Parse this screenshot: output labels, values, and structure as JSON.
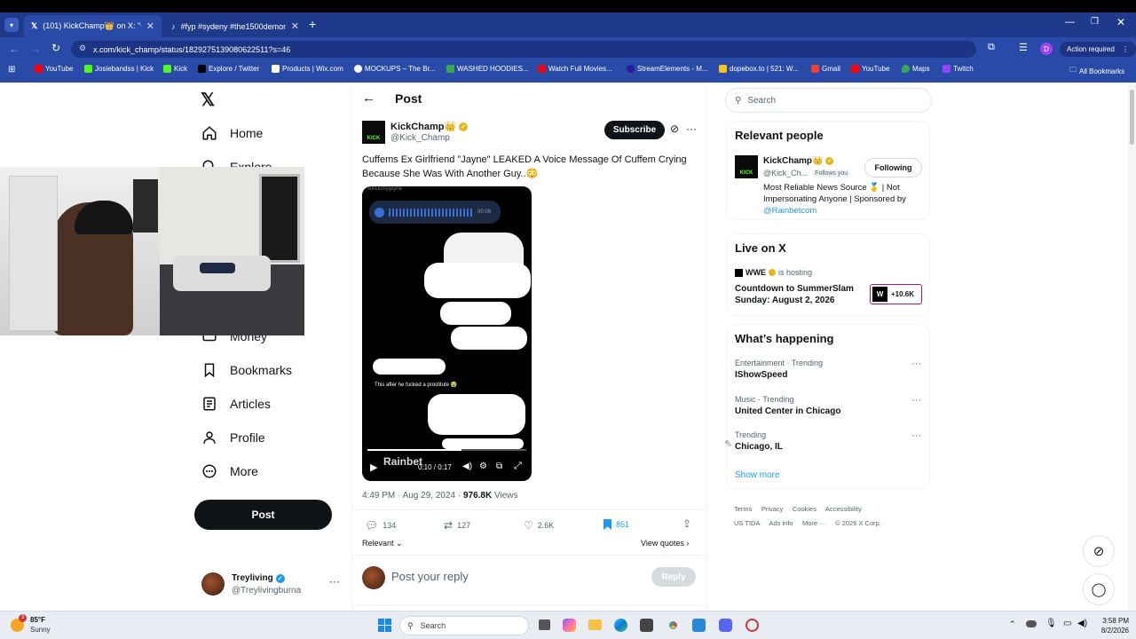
{
  "browser": {
    "tabs": [
      {
        "title": "(101) KickChamp👑 on X: \"Cuff",
        "active": true
      },
      {
        "title": "#fyp #sydeny #the1500demon",
        "active": false
      }
    ],
    "url": "x.com/kick_champ/status/1829275139080622511?s=46",
    "action_required": "Action required",
    "profile_initial": "D",
    "bookmarks": [
      {
        "label": "YouTube",
        "color": "#ff0000"
      },
      {
        "label": "Josiebandss | Kick",
        "color": "#53fc18"
      },
      {
        "label": "Kick",
        "color": "#53fc18"
      },
      {
        "label": "Explore / Twitter",
        "color": "#000000"
      },
      {
        "label": "Products | Wix.com",
        "color": "#ffffff"
      },
      {
        "label": "MOCKUPS – The Br...",
        "color": "#ffffff"
      },
      {
        "label": "WASHED HOODIES...",
        "color": "#34a853"
      },
      {
        "label": "Watch Full Movies...",
        "color": "#e50914"
      },
      {
        "label": "StreamElements - M...",
        "color": "#2d1b9e"
      },
      {
        "label": "dopebox.to | 521: W...",
        "color": "#f5c518"
      },
      {
        "label": "Gmail",
        "color": "#ea4335"
      },
      {
        "label": "YouTube",
        "color": "#ff0000"
      },
      {
        "label": "Maps",
        "color": "#34a853"
      },
      {
        "label": "Twitch",
        "color": "#9146ff"
      }
    ],
    "all_bookmarks": "All Bookmarks"
  },
  "sidebar": {
    "items": [
      {
        "label": "Home",
        "icon": "home-icon"
      },
      {
        "label": "Explore",
        "icon": "search-icon"
      },
      {
        "label": "Money",
        "icon": "money-icon"
      },
      {
        "label": "Bookmarks",
        "icon": "bookmark-icon"
      },
      {
        "label": "Articles",
        "icon": "articles-icon"
      },
      {
        "label": "Profile",
        "icon": "person-icon"
      },
      {
        "label": "More",
        "icon": "more-circle-icon"
      }
    ],
    "post_label": "Post",
    "account": {
      "name": "Treyliving",
      "handle": "@Treylivingburna"
    }
  },
  "post": {
    "header": "Post",
    "author": {
      "name": "KickChamp👑",
      "handle": "@Kick_Champ",
      "avatar_text": "KICK"
    },
    "subscribe": "Subscribe",
    "text": "Cuffems Ex Girlfriend \"Jayne\" LEAKED A Voice Message Of Cuffem Crying Because She Was With Another Guy..😳",
    "video": {
      "time": "0:10 / 0:17",
      "watermark": "Rainbet",
      "caption": "This after he fucked a prostitute 😭",
      "top_name": "stillslumpjayne",
      "voice_time": "00:08",
      "played_fraction": 0.59
    },
    "meta": {
      "time": "4:49 PM · Aug 29, 2024 · ",
      "views_count": "976.8K",
      "views_label": " Views"
    },
    "stats": {
      "replies": "134",
      "reposts": "127",
      "likes": "2.6K",
      "bookmarks": "851"
    },
    "relevant": "Relevant",
    "view_quotes": "View quotes",
    "reply_placeholder": "Post your reply",
    "reply_button": "Reply"
  },
  "right": {
    "search_placeholder": "Search",
    "relevant_people": {
      "title": "Relevant people",
      "name": "KickChamp👑",
      "handle": "@Kick_Ch...",
      "follows_you": "Follows you",
      "following": "Following",
      "bio": "Most Reliable News Source 🥇 | Not Impersonating Anyone | Sponsored by ",
      "bio_link": "@Rainbetcom"
    },
    "live": {
      "title": "Live on X",
      "host": "WWE",
      "hosting": "is hosting",
      "event": "Countdown to SummerSlam Sunday: August 2, 2026",
      "count": "+10.6K"
    },
    "happening": {
      "title": "What’s happening",
      "items": [
        {
          "context": "Entertainment · Trending",
          "topic": "IShowSpeed"
        },
        {
          "context": "Music · Trending",
          "topic": "United Center in Chicago"
        },
        {
          "context": "Trending",
          "topic": "Chicago, IL"
        }
      ],
      "show_more": "Show more"
    },
    "footer": [
      "Terms",
      "Privacy",
      "Cookies",
      "Accessibility",
      "US TIDA",
      "Ads info",
      "More ···",
      "© 2026 X Corp."
    ]
  },
  "taskbar": {
    "temp": "85°F",
    "weather": "Sunny",
    "badge": "3",
    "search": "Search",
    "time": "3:58 PM",
    "date": "8/2/2026"
  }
}
